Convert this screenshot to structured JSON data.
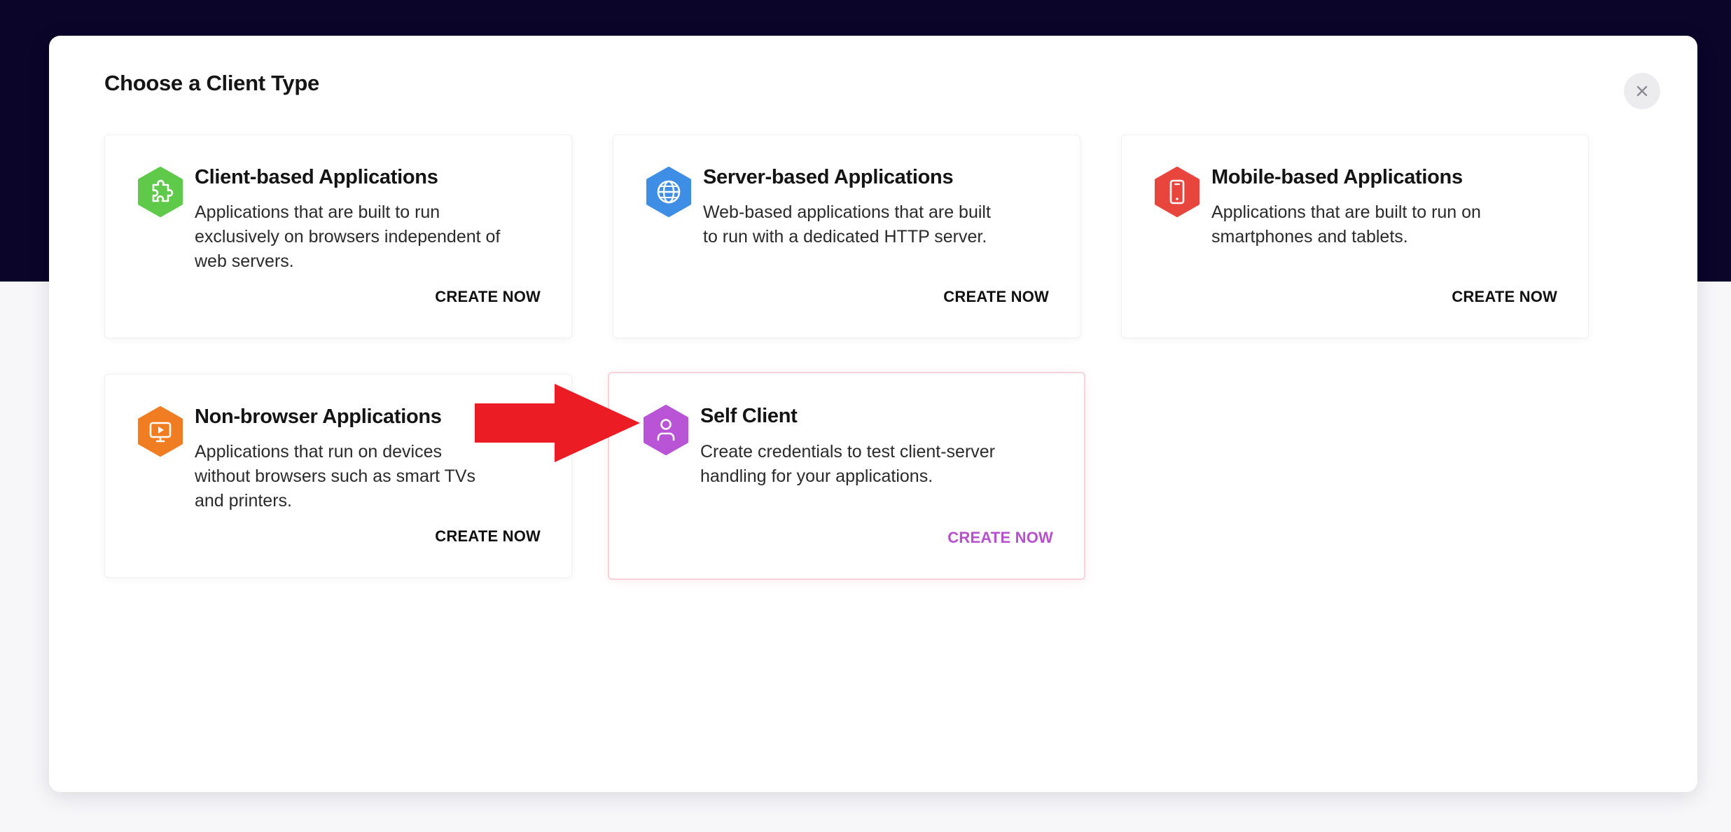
{
  "modal": {
    "title": "Choose a Client Type",
    "close_icon": "close-icon"
  },
  "cards": [
    {
      "title": "Client-based Applications",
      "description": "Applications that are built to run exclusively on browsers independent of web servers.",
      "cta": "CREATE NOW",
      "icon": "puzzle-icon",
      "color": "#5fc94a"
    },
    {
      "title": "Server-based Applications",
      "description": "Web-based applications that are built to run with a dedicated HTTP server.",
      "cta": "CREATE NOW",
      "icon": "globe-icon",
      "color": "#3f8ee6"
    },
    {
      "title": "Mobile-based Applications",
      "description": "Applications that are built to run on smartphones and tablets.",
      "cta": "CREATE NOW",
      "icon": "mobile-phone-icon",
      "color": "#e8453c"
    },
    {
      "title": "Non-browser Applications",
      "description": "Applications that run on devices without browsers such as smart TVs and printers.",
      "cta": "CREATE NOW",
      "icon": "tv-icon",
      "color": "#f07d22"
    },
    {
      "title": "Self Client",
      "description": "Create credentials to test client-server handling for your applications.",
      "cta": "CREATE NOW",
      "icon": "user-icon",
      "color": "#b954d6",
      "selected": true
    }
  ],
  "annotation": {
    "arrow_color": "#ec1c24",
    "icon": "arrow-right-icon"
  }
}
